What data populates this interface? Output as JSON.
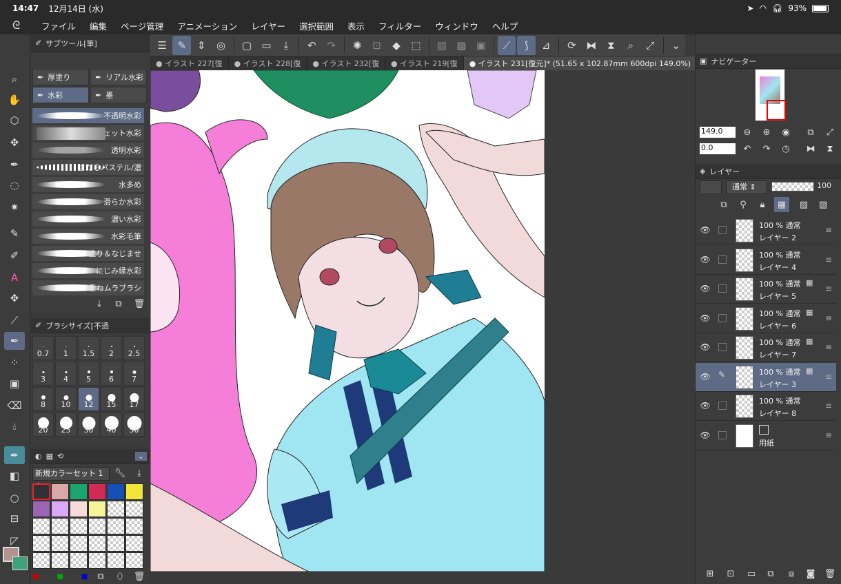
{
  "status": {
    "time": "14:47",
    "date": "12月14日 (水)",
    "battery": "93%"
  },
  "menu": [
    "ファイル",
    "編集",
    "ページ管理",
    "アニメーション",
    "レイヤー",
    "選択範囲",
    "表示",
    "フィルター",
    "ウィンドウ",
    "ヘルプ"
  ],
  "tabs": [
    {
      "label": "● イラスト 227[復"
    },
    {
      "label": "● イラスト 228[復"
    },
    {
      "label": "● イラスト 232[復"
    },
    {
      "label": "● イラスト 219[復"
    },
    {
      "label": "● イラスト 231[復元]* (51.65 x 102.87mm 600dpi 149.0%)"
    }
  ],
  "subtool": {
    "header": "サブツール[筆]",
    "groups": [
      "厚塗り",
      "リアル水彩",
      "水彩",
      "墨"
    ],
    "brushes": [
      "不透明水彩",
      "ウェット水彩",
      "透明水彩",
      "まだらパステル/濃",
      "水多め",
      "滑らか水彩",
      "濃い水彩",
      "水彩毛筆",
      "塗り＆なじませ",
      "にじみ縁水彩",
      "重ねムラブラシ"
    ]
  },
  "brushSize": {
    "header": "ブラシサイズ[不透",
    "sizes": [
      "0.7",
      "1",
      "1.5",
      "2",
      "2.5",
      "3",
      "4",
      "5",
      "6",
      "7",
      "8",
      "10",
      "12",
      "15",
      "17",
      "20",
      "25",
      "30",
      "40",
      "50"
    ]
  },
  "colorSet": {
    "name": "新規カラーセット 1",
    "colors": [
      "#2e3236",
      "#dba8a8",
      "#1aa56e",
      "#d02a55",
      "#1650b5",
      "#f3e438",
      "#9b65b6",
      "#dba8f5",
      "#f6dcd8",
      "#f6f59a"
    ]
  },
  "navigator": {
    "header": "ナビゲーター",
    "zoom": "149.0",
    "rotation": "0.0"
  },
  "layers": {
    "header": "レイヤー",
    "blend": "通常",
    "opacity": "100",
    "items": [
      {
        "line1": "100 %  通常",
        "line2": "レイヤー 2"
      },
      {
        "line1": "100 %  通常",
        "line2": "レイヤー 4"
      },
      {
        "line1": "100 %  通常",
        "line2": "レイヤー 5"
      },
      {
        "line1": "100 %  通常",
        "line2": "レイヤー 6"
      },
      {
        "line1": "100 %  通常",
        "line2": "レイヤー 7"
      },
      {
        "line1": "100 %  通常",
        "line2": "レイヤー 3"
      },
      {
        "line1": "100 %  通常",
        "line2": "レイヤー 8"
      },
      {
        "line1": "",
        "line2": "用紙"
      }
    ]
  }
}
